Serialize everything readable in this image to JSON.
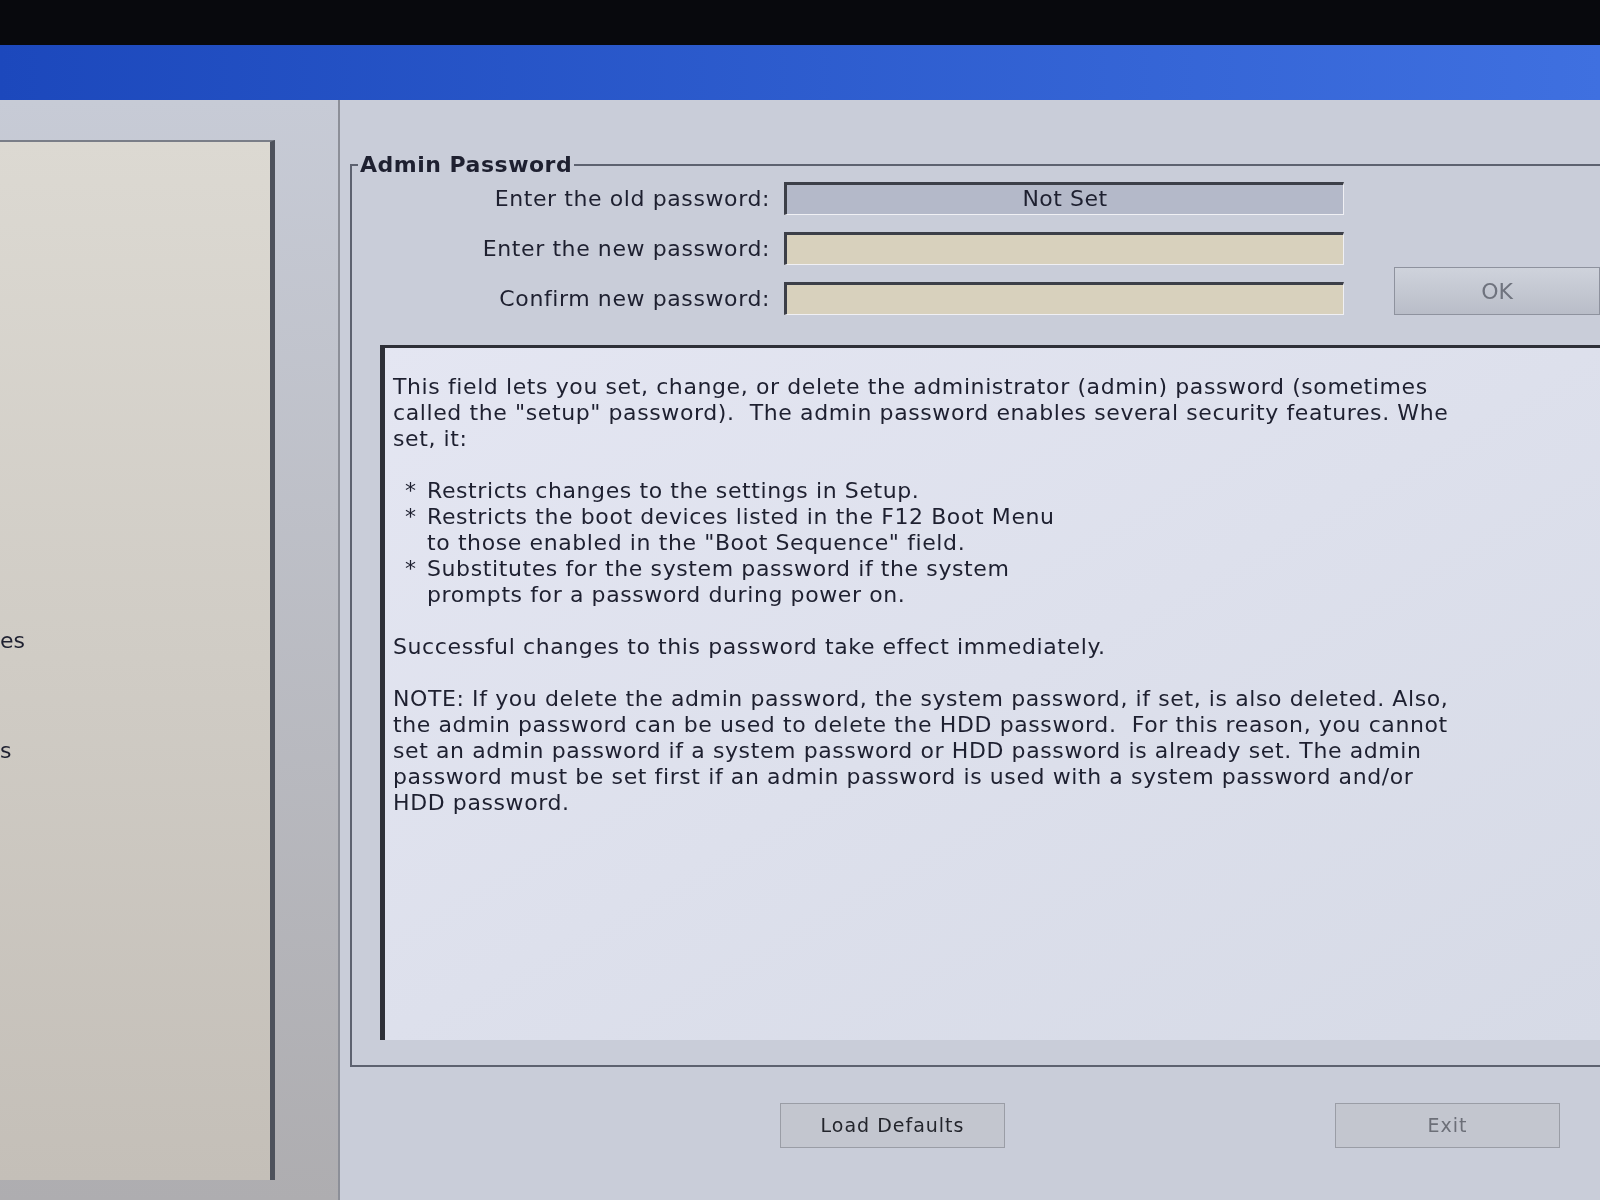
{
  "sidebar": {
    "items": [
      "es",
      "s"
    ]
  },
  "admin_password": {
    "title": "Admin Password",
    "fields": [
      {
        "label": "Enter the old password:",
        "value": "Not Set",
        "disabled": true
      },
      {
        "label": "Enter the new password:",
        "disabled": false
      },
      {
        "label": "Confirm new password:",
        "disabled": false
      }
    ],
    "ok_button": {
      "label": "OK",
      "disabled": true
    }
  },
  "help": {
    "blocks": [
      {
        "kind": "paragraph",
        "lines": [
          "This field lets you set, change, or delete the administrator (admin) password (sometimes",
          "called the \"setup\" password).  The admin password enables several security features. Whe",
          "set, it:"
        ]
      },
      {
        "kind": "bullet_list",
        "items": [
          {
            "marker": "*",
            "lines": [
              "Restricts changes to the settings in Setup."
            ]
          },
          {
            "marker": "*",
            "lines": [
              "Restricts the boot devices listed in the F12 Boot Menu",
              "to those enabled in the \"Boot Sequence\" field."
            ]
          },
          {
            "marker": "*",
            "lines": [
              "Substitutes for the system password if the system",
              "prompts for a password during power on."
            ]
          }
        ]
      },
      {
        "kind": "paragraph",
        "lines": [
          "Successful changes to this password take effect immediately."
        ]
      },
      {
        "kind": "paragraph",
        "lines": [
          "NOTE: If you delete the admin password, the system password, if set, is also deleted. Also,",
          "the admin password can be used to delete the HDD password.  For this reason, you cannot",
          "set an admin password if a system password or HDD password is already set. The admin",
          "password must be set first if an admin password is used with a system password and/or",
          "HDD password."
        ]
      }
    ]
  },
  "buttons": [
    {
      "label": "Load Defaults",
      "disabled": false
    },
    {
      "label": "Exit",
      "disabled": true
    }
  ]
}
